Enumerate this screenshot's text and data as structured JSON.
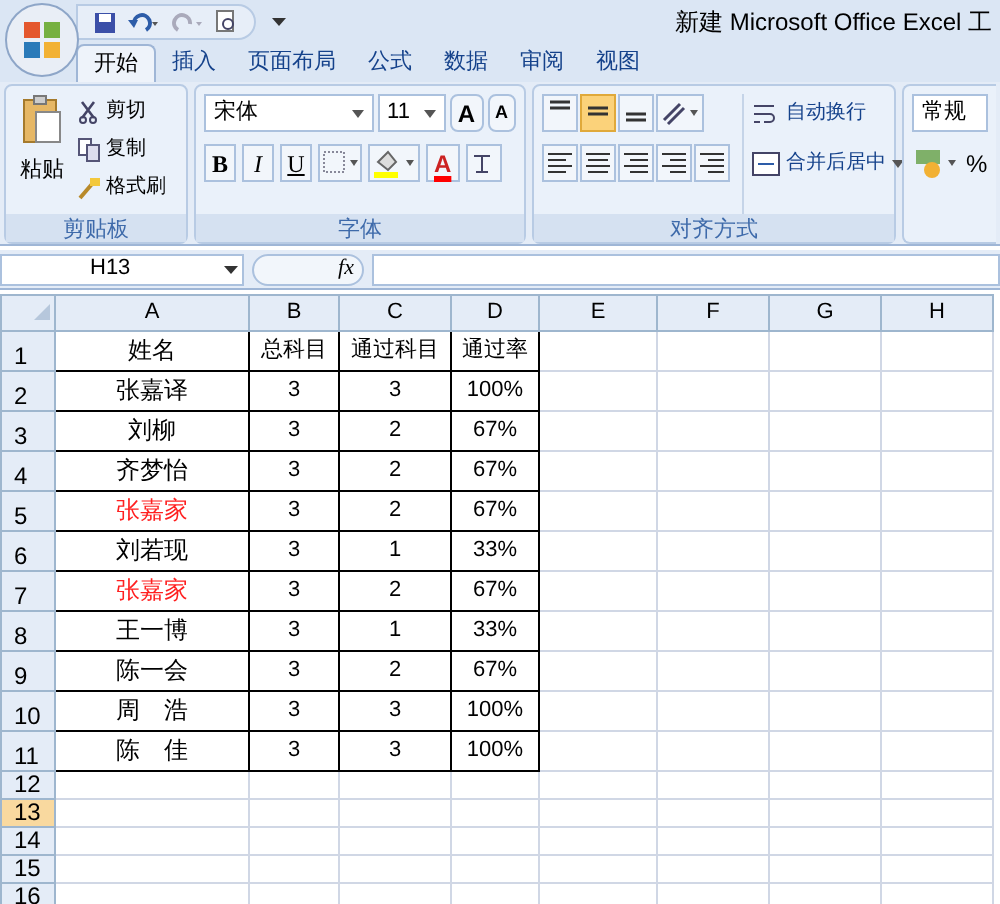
{
  "title": "新建 Microsoft Office Excel 工",
  "tabs": [
    {
      "label": "开始",
      "selected": true
    },
    {
      "label": "插入",
      "selected": false
    },
    {
      "label": "页面布局",
      "selected": false
    },
    {
      "label": "公式",
      "selected": false
    },
    {
      "label": "数据",
      "selected": false
    },
    {
      "label": "审阅",
      "selected": false
    },
    {
      "label": "视图",
      "selected": false
    }
  ],
  "clipboard": {
    "paste": "粘贴",
    "items": [
      "剪切",
      "复制",
      "格式刷"
    ],
    "label": "剪贴板"
  },
  "font": {
    "name": "宋体",
    "size": "11",
    "bold": "B",
    "italic": "I",
    "underline": "U",
    "grow": "A",
    "shrink": "A",
    "color_button": "A",
    "label": "字体"
  },
  "alignment": {
    "vertical": [
      {
        "selected": false
      },
      {
        "selected": true
      },
      {
        "selected": false
      }
    ],
    "wrap": "自动换行",
    "merge": "合并后居中",
    "label": "对齐方式"
  },
  "number": {
    "format": "常规",
    "percent": "%"
  },
  "name_box": "H13",
  "fx": "fx",
  "sheet": {
    "columns": [
      {
        "label": "A",
        "selected": false
      },
      {
        "label": "B",
        "selected": false
      },
      {
        "label": "C",
        "selected": false
      },
      {
        "label": "D",
        "selected": false
      },
      {
        "label": "E",
        "selected": false
      },
      {
        "label": "F",
        "selected": false
      },
      {
        "label": "G",
        "selected": false
      },
      {
        "label": "H",
        "selected": false
      }
    ],
    "rows": [
      {
        "header": "1",
        "selected": false,
        "cells": [
          "姓名",
          "总科目",
          "通过科目",
          "通过率"
        ],
        "red_name": false
      },
      {
        "header": "2",
        "selected": false,
        "cells": [
          "张嘉译",
          "3",
          "3",
          "100%"
        ],
        "red_name": false
      },
      {
        "header": "3",
        "selected": false,
        "cells": [
          "刘柳",
          "3",
          "2",
          "67%"
        ],
        "red_name": false
      },
      {
        "header": "4",
        "selected": false,
        "cells": [
          "齐梦怡",
          "3",
          "2",
          "67%"
        ],
        "red_name": false
      },
      {
        "header": "5",
        "selected": false,
        "cells": [
          "张嘉家",
          "3",
          "2",
          "67%"
        ],
        "red_name": true
      },
      {
        "header": "6",
        "selected": false,
        "cells": [
          "刘若现",
          "3",
          "1",
          "33%"
        ],
        "red_name": false
      },
      {
        "header": "7",
        "selected": false,
        "cells": [
          "张嘉家",
          "3",
          "2",
          "67%"
        ],
        "red_name": true
      },
      {
        "header": "8",
        "selected": false,
        "cells": [
          "王一博",
          "3",
          "1",
          "33%"
        ],
        "red_name": false
      },
      {
        "header": "9",
        "selected": false,
        "cells": [
          "陈一会",
          "3",
          "2",
          "67%"
        ],
        "red_name": false
      },
      {
        "header": "10",
        "selected": false,
        "cells": [
          "周　浩",
          "3",
          "3",
          "100%"
        ],
        "red_name": false
      },
      {
        "header": "11",
        "selected": false,
        "cells": [
          "陈　佳",
          "3",
          "3",
          "100%"
        ],
        "red_name": false
      },
      {
        "header": "12",
        "selected": false,
        "cells": []
      },
      {
        "header": "13",
        "selected": true,
        "cells": []
      },
      {
        "header": "14",
        "selected": false,
        "cells": []
      },
      {
        "header": "15",
        "selected": false,
        "cells": []
      },
      {
        "header": "16",
        "selected": false,
        "cells": []
      }
    ]
  }
}
